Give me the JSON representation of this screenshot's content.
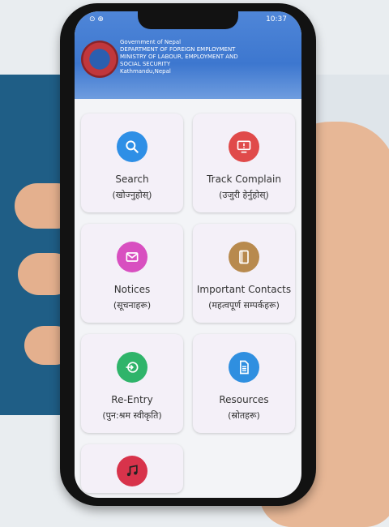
{
  "status_bar": {
    "left": "⊙ ⊕",
    "time": "10:37"
  },
  "header": {
    "lines": [
      "Government of Nepal",
      "DEPARTMENT OF FOREIGN EMPLOYMENT",
      "MINISTRY OF LABOUR, EMPLOYMENT AND",
      "SOCIAL SECURITY",
      "Kathmandu,Nepal"
    ]
  },
  "menu": [
    {
      "label": "Search",
      "sub": "(खोज्नुहोस्)",
      "color": "#2e8fe6",
      "icon": "search-icon"
    },
    {
      "label": "Track Complain",
      "sub": "(उजुरी हेर्नुहोस्)",
      "color": "#e04a4a",
      "icon": "monitor-icon"
    },
    {
      "label": "Notices",
      "sub": "(सूचनाहरू)",
      "color": "#d84fc0",
      "icon": "mail-icon"
    },
    {
      "label": "Important Contacts",
      "sub": "(महत्वपूर्ण सम्पर्कहरू)",
      "color": "#b88a4e",
      "icon": "book-icon"
    },
    {
      "label": "Re-Entry",
      "sub": "(पुन:श्रम स्वीकृति)",
      "color": "#2fb46a",
      "icon": "enter-icon"
    },
    {
      "label": "Resources",
      "sub": "(स्रोतहरू)",
      "color": "#2f8fe0",
      "icon": "document-icon"
    }
  ],
  "partial_card": {
    "color": "#d8334b",
    "icon": "music-icon"
  }
}
